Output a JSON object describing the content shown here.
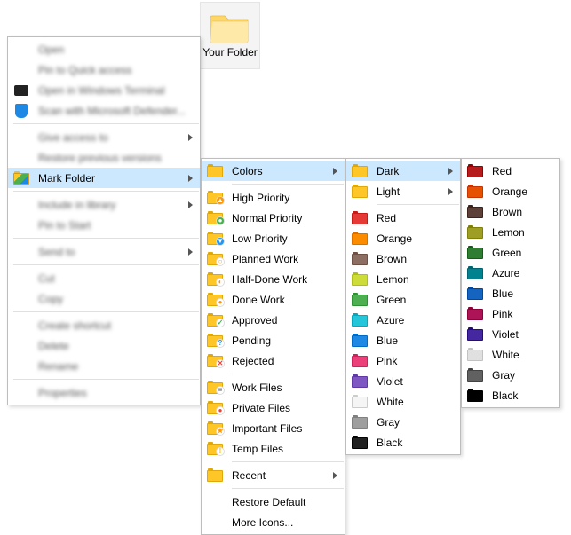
{
  "folder": {
    "label": "Your Folder"
  },
  "menu1": {
    "items": [
      {
        "label": "Open",
        "blur": true
      },
      {
        "label": "Pin to Quick access",
        "blur": true
      },
      {
        "label": "Open in Windows Terminal",
        "blur": true,
        "icon": "terminal"
      },
      {
        "label": "Scan with Microsoft Defender...",
        "blur": true,
        "icon": "defender"
      },
      "sep",
      {
        "label": "Give access to",
        "blur": true,
        "arrow": true
      },
      {
        "label": "Restore previous versions",
        "blur": true
      },
      {
        "label": "Mark Folder",
        "blur": false,
        "arrow": true,
        "icon": "markfolder",
        "highlight": true
      },
      "sep",
      {
        "label": "Include in library",
        "blur": true,
        "arrow": true
      },
      {
        "label": "Pin to Start",
        "blur": true
      },
      "sep",
      {
        "label": "Send to",
        "blur": true,
        "arrow": true
      },
      "sep",
      {
        "label": "Cut",
        "blur": true
      },
      {
        "label": "Copy",
        "blur": true
      },
      "sep",
      {
        "label": "Create shortcut",
        "blur": true
      },
      {
        "label": "Delete",
        "blur": true
      },
      {
        "label": "Rename",
        "blur": true
      },
      "sep",
      {
        "label": "Properties",
        "blur": true
      }
    ]
  },
  "menu2": {
    "items": [
      {
        "label": "Colors",
        "arrow": true,
        "highlight": true,
        "color": "#ffc627"
      },
      "sep",
      {
        "label": "High Priority",
        "color": "#ffc627",
        "mark": {
          "bg": "#ff9800",
          "txt": "▲",
          "fg": "#fff"
        }
      },
      {
        "label": "Normal Priority",
        "color": "#ffc627",
        "mark": {
          "bg": "#4caf50",
          "txt": "●",
          "fg": "#fff"
        }
      },
      {
        "label": "Low Priority",
        "color": "#ffc627",
        "mark": {
          "bg": "#2196f3",
          "txt": "▼",
          "fg": "#fff"
        }
      },
      {
        "label": "Planned Work",
        "color": "#ffc627",
        "mark": {
          "bg": "#fff",
          "txt": "○",
          "fg": "#ff9800"
        }
      },
      {
        "label": "Half-Done Work",
        "color": "#ffc627",
        "mark": {
          "bg": "#fff",
          "txt": "◐",
          "fg": "#ff9800"
        }
      },
      {
        "label": "Done Work",
        "color": "#ffc627",
        "mark": {
          "bg": "#fff",
          "txt": "●",
          "fg": "#ff9800"
        }
      },
      {
        "label": "Approved",
        "color": "#ffc627",
        "mark": {
          "bg": "#fff",
          "txt": "✓",
          "fg": "#4caf50"
        }
      },
      {
        "label": "Pending",
        "color": "#ffc627",
        "mark": {
          "bg": "#fff",
          "txt": "?",
          "fg": "#2196f3"
        }
      },
      {
        "label": "Rejected",
        "color": "#ffc627",
        "mark": {
          "bg": "#fff",
          "txt": "✕",
          "fg": "#f44336"
        }
      },
      "sep",
      {
        "label": "Work Files",
        "color": "#ffc627",
        "mark": {
          "bg": "#fff",
          "txt": "≡",
          "fg": "#666"
        }
      },
      {
        "label": "Private Files",
        "color": "#ffc627",
        "mark": {
          "bg": "#fff",
          "txt": "●",
          "fg": "#f44336"
        }
      },
      {
        "label": "Important Files",
        "color": "#ffc627",
        "mark": {
          "bg": "#fff",
          "txt": "★",
          "fg": "#ff9800"
        }
      },
      {
        "label": "Temp Files",
        "color": "#ffc627",
        "mark": {
          "bg": "#fff",
          "txt": "!",
          "fg": "#ffc107"
        }
      },
      "sep",
      {
        "label": "Recent",
        "arrow": true,
        "color": "#ffc627"
      },
      "sep",
      {
        "label": "Restore Default"
      },
      {
        "label": "More Icons..."
      }
    ]
  },
  "menu3": {
    "items": [
      {
        "label": "Dark",
        "arrow": true,
        "highlight": true,
        "color": "#ffc627"
      },
      {
        "label": "Light",
        "arrow": true,
        "color": "#ffc627"
      },
      "sep",
      {
        "label": "Red",
        "color": "#e53935"
      },
      {
        "label": "Orange",
        "color": "#fb8c00"
      },
      {
        "label": "Brown",
        "color": "#8d6e63"
      },
      {
        "label": "Lemon",
        "color": "#cddc39"
      },
      {
        "label": "Green",
        "color": "#4caf50"
      },
      {
        "label": "Azure",
        "color": "#26c6da"
      },
      {
        "label": "Blue",
        "color": "#1e88e5"
      },
      {
        "label": "Pink",
        "color": "#ec407a"
      },
      {
        "label": "Violet",
        "color": "#7e57c2"
      },
      {
        "label": "White",
        "color": "#f5f5f5",
        "stroke": "#ccc"
      },
      {
        "label": "Gray",
        "color": "#9e9e9e"
      },
      {
        "label": "Black",
        "color": "#212121"
      }
    ]
  },
  "menu4": {
    "items": [
      {
        "label": "Red",
        "color": "#b71c1c"
      },
      {
        "label": "Orange",
        "color": "#e65100"
      },
      {
        "label": "Brown",
        "color": "#5d4037"
      },
      {
        "label": "Lemon",
        "color": "#9e9d24"
      },
      {
        "label": "Green",
        "color": "#2e7d32"
      },
      {
        "label": "Azure",
        "color": "#00838f"
      },
      {
        "label": "Blue",
        "color": "#1565c0"
      },
      {
        "label": "Pink",
        "color": "#ad1457"
      },
      {
        "label": "Violet",
        "color": "#4527a0"
      },
      {
        "label": "White",
        "color": "#e0e0e0"
      },
      {
        "label": "Gray",
        "color": "#616161"
      },
      {
        "label": "Black",
        "color": "#000000"
      }
    ]
  }
}
